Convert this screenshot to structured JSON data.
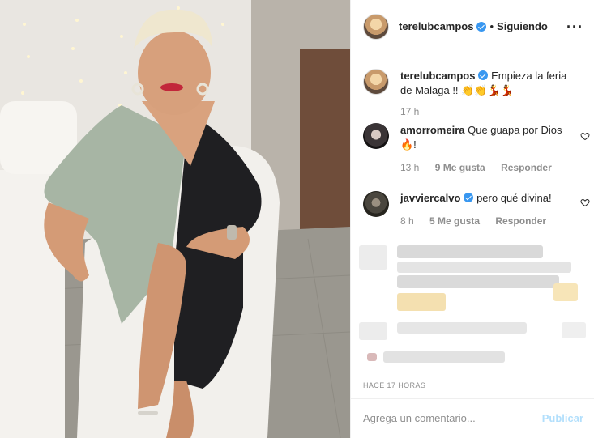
{
  "header": {
    "username": "terelubcampos",
    "separator": "•",
    "follow_status": "Siguiendo",
    "more_icon": "more-horizontal-icon"
  },
  "caption": {
    "username": "terelubcampos",
    "text": "Empieza la feria de Malaga !! 👏👏💃💃",
    "time": "17 h"
  },
  "comments": [
    {
      "username": "amorromeira",
      "verified": false,
      "text": "Que guapa por Dios 🔥!",
      "time": "13 h",
      "likes": "9 Me gusta",
      "reply": "Responder"
    },
    {
      "username": "javviercalvo",
      "verified": true,
      "text": "pero qué divina!",
      "time": "8 h",
      "likes": "5 Me gusta",
      "reply": "Responder"
    }
  ],
  "post_time": "HACE 17 HORAS",
  "comment_box": {
    "placeholder": "Agrega un comentario...",
    "submit_label": "Publicar"
  },
  "colors": {
    "verified_blue": "#3897f0",
    "muted_text": "#8e8e8e",
    "post_button_disabled": "#b2dffc"
  }
}
